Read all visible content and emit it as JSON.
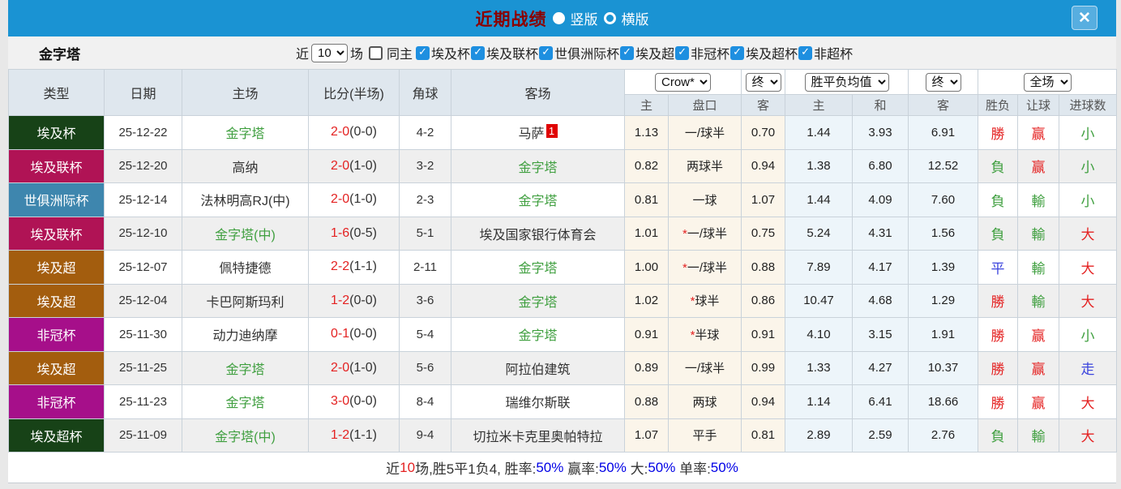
{
  "titlebar": {
    "title": "近期战绩",
    "vertical_label": "竖版",
    "horizontal_label": "横版",
    "vertical_selected": true,
    "close_label": "✕"
  },
  "filterbar": {
    "team": "金字塔",
    "recent_label": "近",
    "recent_value": "10",
    "games_label": "场",
    "same_home_label": "同主",
    "same_home_checked": false,
    "competitions": [
      {
        "label": "埃及杯",
        "checked": true
      },
      {
        "label": "埃及联杯",
        "checked": true
      },
      {
        "label": "世俱洲际杯",
        "checked": true
      },
      {
        "label": "埃及超",
        "checked": true
      },
      {
        "label": "非冠杯",
        "checked": true
      },
      {
        "label": "埃及超杯",
        "checked": true
      },
      {
        "label": "非超杯",
        "checked": true
      }
    ]
  },
  "table": {
    "main_headers": [
      "类型",
      "日期",
      "主场",
      "比分(半场)",
      "角球",
      "客场"
    ],
    "selects": {
      "company": "Crow*",
      "asian_time": "终",
      "europe": "胜平负均值",
      "europe_time": "终",
      "scope": "全场"
    },
    "sub_headers": [
      "主",
      "盘口",
      "客",
      "主",
      "和",
      "客",
      "胜负",
      "让球",
      "进球数"
    ],
    "rows": [
      {
        "type": "埃及杯",
        "type_color": "#174217",
        "date": "25-12-22",
        "home": "金字塔",
        "home_green": true,
        "ft": "2-0",
        "ht": "(0-0)",
        "corner": "4-2",
        "away": "马萨",
        "away_green": false,
        "away_badge": "1",
        "ah": "1.13",
        "hcap": "一/球半",
        "star": false,
        "aa": "0.70",
        "eh": "1.44",
        "ed": "3.93",
        "ea": "6.91",
        "res": "勝",
        "res_c": "red",
        "hres": "赢",
        "hres_c": "red",
        "g": "小",
        "g_c": "green"
      },
      {
        "type": "埃及联杯",
        "type_color": "#b01355",
        "date": "25-12-20",
        "home": "高纳",
        "home_green": false,
        "ft": "2-0",
        "ht": "(1-0)",
        "corner": "3-2",
        "away": "金字塔",
        "away_green": true,
        "away_badge": "",
        "ah": "0.82",
        "hcap": "两球半",
        "star": false,
        "aa": "0.94",
        "eh": "1.38",
        "ed": "6.80",
        "ea": "12.52",
        "res": "負",
        "res_c": "green",
        "hres": "赢",
        "hres_c": "red",
        "g": "小",
        "g_c": "green"
      },
      {
        "type": "世俱洲际杯",
        "type_color": "#3e86ae",
        "date": "25-12-14",
        "home": "法林明高RJ(中)",
        "home_green": false,
        "ft": "2-0",
        "ht": "(1-0)",
        "corner": "2-3",
        "away": "金字塔",
        "away_green": true,
        "away_badge": "",
        "ah": "0.81",
        "hcap": "一球",
        "star": false,
        "aa": "1.07",
        "eh": "1.44",
        "ed": "4.09",
        "ea": "7.60",
        "res": "負",
        "res_c": "green",
        "hres": "輸",
        "hres_c": "green",
        "g": "小",
        "g_c": "green"
      },
      {
        "type": "埃及联杯",
        "type_color": "#b01355",
        "date": "25-12-10",
        "home": "金字塔(中)",
        "home_green": true,
        "ft": "1-6",
        "ht": "(0-5)",
        "corner": "5-1",
        "away": "埃及国家银行体育会",
        "away_green": false,
        "away_badge": "",
        "ah": "1.01",
        "hcap": "一/球半",
        "star": true,
        "aa": "0.75",
        "eh": "5.24",
        "ed": "4.31",
        "ea": "1.56",
        "res": "負",
        "res_c": "green",
        "hres": "輸",
        "hres_c": "green",
        "g": "大",
        "g_c": "red"
      },
      {
        "type": "埃及超",
        "type_color": "#a35d0e",
        "date": "25-12-07",
        "home": "佩特捷德",
        "home_green": false,
        "ft": "2-2",
        "ht": "(1-1)",
        "corner": "2-11",
        "away": "金字塔",
        "away_green": true,
        "away_badge": "",
        "ah": "1.00",
        "hcap": "一/球半",
        "star": true,
        "aa": "0.88",
        "eh": "7.89",
        "ed": "4.17",
        "ea": "1.39",
        "res": "平",
        "res_c": "blue",
        "hres": "輸",
        "hres_c": "green",
        "g": "大",
        "g_c": "red"
      },
      {
        "type": "埃及超",
        "type_color": "#a35d0e",
        "date": "25-12-04",
        "home": "卡巴阿斯玛利",
        "home_green": false,
        "ft": "1-2",
        "ht": "(0-0)",
        "corner": "3-6",
        "away": "金字塔",
        "away_green": true,
        "away_badge": "",
        "ah": "1.02",
        "hcap": "球半",
        "star": true,
        "aa": "0.86",
        "eh": "10.47",
        "ed": "4.68",
        "ea": "1.29",
        "res": "勝",
        "res_c": "red",
        "hres": "輸",
        "hres_c": "green",
        "g": "大",
        "g_c": "red"
      },
      {
        "type": "非冠杯",
        "type_color": "#a60f8a",
        "date": "25-11-30",
        "home": "动力迪纳摩",
        "home_green": false,
        "ft": "0-1",
        "ht": "(0-0)",
        "corner": "5-4",
        "away": "金字塔",
        "away_green": true,
        "away_badge": "",
        "ah": "0.91",
        "hcap": "半球",
        "star": true,
        "aa": "0.91",
        "eh": "4.10",
        "ed": "3.15",
        "ea": "1.91",
        "res": "勝",
        "res_c": "red",
        "hres": "赢",
        "hres_c": "red",
        "g": "小",
        "g_c": "green"
      },
      {
        "type": "埃及超",
        "type_color": "#a35d0e",
        "date": "25-11-25",
        "home": "金字塔",
        "home_green": true,
        "ft": "2-0",
        "ht": "(1-0)",
        "corner": "5-6",
        "away": "阿拉伯建筑",
        "away_green": false,
        "away_badge": "",
        "ah": "0.89",
        "hcap": "一/球半",
        "star": false,
        "aa": "0.99",
        "eh": "1.33",
        "ed": "4.27",
        "ea": "10.37",
        "res": "勝",
        "res_c": "red",
        "hres": "赢",
        "hres_c": "red",
        "g": "走",
        "g_c": "blue"
      },
      {
        "type": "非冠杯",
        "type_color": "#a60f8a",
        "date": "25-11-23",
        "home": "金字塔",
        "home_green": true,
        "ft": "3-0",
        "ht": "(0-0)",
        "corner": "8-4",
        "away": "瑞维尔斯联",
        "away_green": false,
        "away_badge": "",
        "ah": "0.88",
        "hcap": "两球",
        "star": false,
        "aa": "0.94",
        "eh": "1.14",
        "ed": "6.41",
        "ea": "18.66",
        "res": "勝",
        "res_c": "red",
        "hres": "赢",
        "hres_c": "red",
        "g": "大",
        "g_c": "red"
      },
      {
        "type": "埃及超杯",
        "type_color": "#174217",
        "date": "25-11-09",
        "home": "金字塔(中)",
        "home_green": true,
        "ft": "1-2",
        "ht": "(1-1)",
        "corner": "9-4",
        "away": "切拉米卡克里奥帕特拉",
        "away_green": false,
        "away_badge": "",
        "ah": "1.07",
        "hcap": "平手",
        "star": false,
        "aa": "0.81",
        "eh": "2.89",
        "ed": "2.59",
        "ea": "2.76",
        "res": "負",
        "res_c": "green",
        "hres": "輸",
        "hres_c": "green",
        "g": "大",
        "g_c": "red"
      }
    ]
  },
  "summary": {
    "parts": [
      {
        "t": "近",
        "c": "dark"
      },
      {
        "t": "10",
        "c": "red"
      },
      {
        "t": "场,胜5平1负4, 胜率:",
        "c": "dark"
      },
      {
        "t": "50%",
        "c": "sum_blue"
      },
      {
        "t": " 赢率:",
        "c": "dark"
      },
      {
        "t": "50%",
        "c": "sum_blue"
      },
      {
        "t": " 大:",
        "c": "dark"
      },
      {
        "t": "50%",
        "c": "sum_blue"
      },
      {
        "t": " 单率:",
        "c": "dark"
      },
      {
        "t": "50%",
        "c": "sum_blue"
      }
    ]
  },
  "colors": {
    "red": "#e42222",
    "green": "#3f9f3f",
    "blue": "#3b44dd",
    "dark": "#333333",
    "sum_blue": "#0000e6",
    "titlebar_bg": "#1a93d3",
    "title_red": "#8b0000",
    "badge_red": "#e00000"
  }
}
